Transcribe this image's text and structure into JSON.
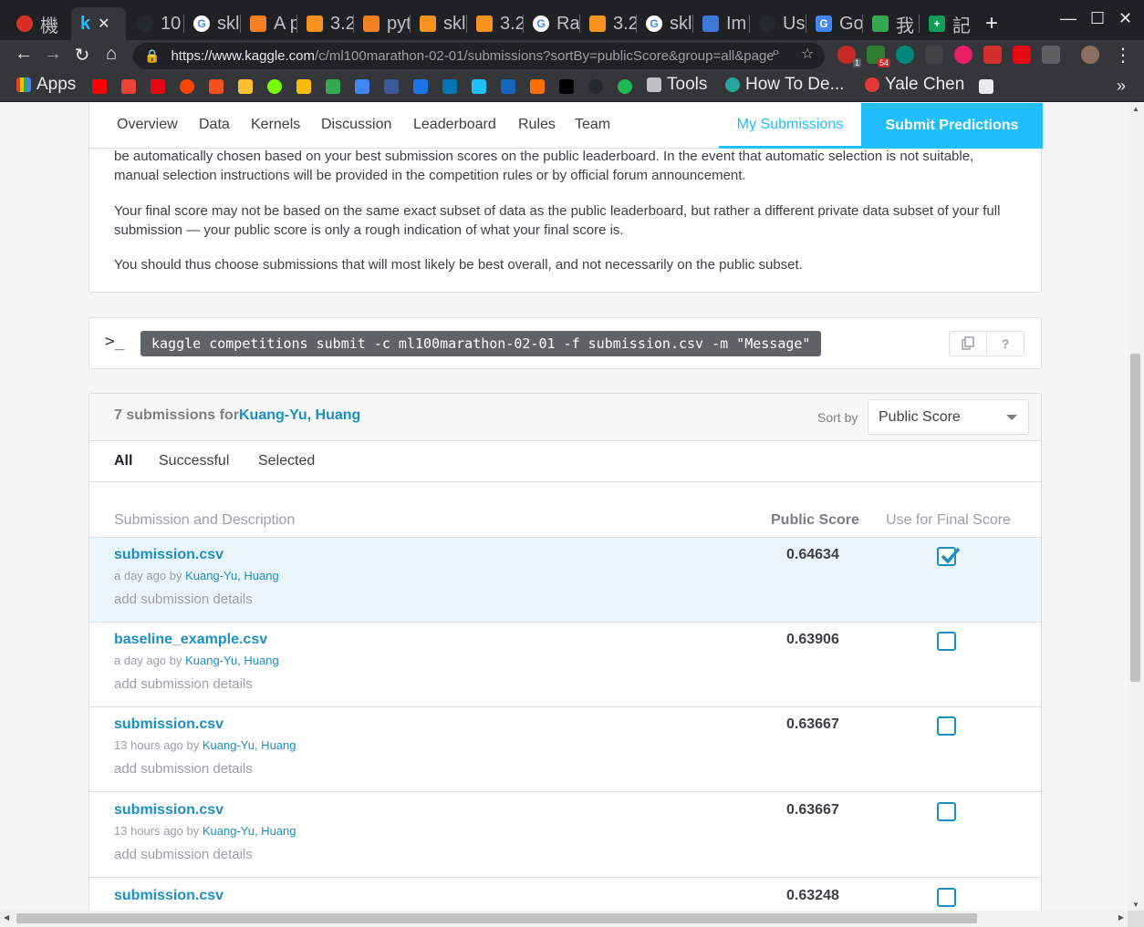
{
  "browser": {
    "tabs": [
      {
        "label": "機",
        "color": "#d93025"
      },
      {
        "label": "k",
        "color": "#20beff"
      },
      {
        "label": "10",
        "color": "#24292e"
      },
      {
        "label": "skl",
        "color": "#4285f4"
      },
      {
        "label": "A p",
        "color": "#f48024"
      },
      {
        "label": "3.2",
        "color": "#f7931e"
      },
      {
        "label": "pyt",
        "color": "#f48024"
      },
      {
        "label": "skl",
        "color": "#f7931e"
      },
      {
        "label": "3.2",
        "color": "#f7931e"
      },
      {
        "label": "Ra",
        "color": "#4285f4"
      },
      {
        "label": "3.2",
        "color": "#f7931e"
      },
      {
        "label": "skl",
        "color": "#4285f4"
      },
      {
        "label": "Im",
        "color": "#3c78d8"
      },
      {
        "label": "Us",
        "color": "#24292e"
      },
      {
        "label": "Go",
        "color": "#4285f4"
      },
      {
        "label": "我",
        "color": "#34a853"
      },
      {
        "label": "記",
        "color": "#0f9d58"
      }
    ],
    "url_host": "https://www.kaggle.com",
    "url_path": "/c/ml100marathon-02-01/submissions?sortBy=publicScore&group=all&page=...",
    "ext_badges": {
      "first": "1",
      "second": "54"
    },
    "bookmarks": {
      "apps": "Apps",
      "tools": "Tools",
      "howto": "How To De...",
      "yale": "Yale Chen"
    }
  },
  "comp_nav": {
    "items": [
      "Overview",
      "Data",
      "Kernels",
      "Discussion",
      "Leaderboard",
      "Rules",
      "Team"
    ],
    "my_submissions": "My Submissions",
    "submit_predictions": "Submit Predictions"
  },
  "rules": {
    "p1": "be automatically chosen based on your best submission scores on the public leaderboard. In the event that automatic selection is not suitable, manual selection instructions will be provided in the competition rules or by official forum announcement.",
    "p2": "Your final score may not be based on the same exact subset of data as the public leaderboard, but rather a different private data subset of your full submission — your public score is only a rough indication of what your final score is.",
    "p3": "You should thus choose submissions that will most likely be best overall, and not necessarily on the public subset."
  },
  "api": {
    "prompt": ">_",
    "command": "kaggle competitions submit -c ml100marathon-02-01 -f submission.csv -m \"Message\"",
    "help": "?"
  },
  "submissions": {
    "count_text": "7 submissions for",
    "owner": "Kuang-Yu, Huang",
    "sort_label": "Sort by",
    "sort_value": "Public Score",
    "filters": [
      "All",
      "Successful",
      "Selected"
    ],
    "columns": {
      "desc": "Submission and Description",
      "score": "Public Score",
      "final": "Use for Final Score"
    },
    "rows": [
      {
        "file": "submission.csv",
        "time": "a day ago by",
        "by": "Kuang-Yu, Huang",
        "details": "add submission details",
        "score": "0.64634",
        "selected": true
      },
      {
        "file": "baseline_example.csv",
        "time": "a day ago by",
        "by": "Kuang-Yu, Huang",
        "details": "add submission details",
        "score": "0.63906",
        "selected": false
      },
      {
        "file": "submission.csv",
        "time": "13 hours ago by",
        "by": "Kuang-Yu, Huang",
        "details": "add submission details",
        "score": "0.63667",
        "selected": false
      },
      {
        "file": "submission.csv",
        "time": "13 hours ago by",
        "by": "Kuang-Yu, Huang",
        "details": "add submission details",
        "score": "0.63667",
        "selected": false
      },
      {
        "file": "submission.csv",
        "time": "",
        "by": "",
        "details": "",
        "score": "0.63248",
        "selected": false
      }
    ]
  }
}
